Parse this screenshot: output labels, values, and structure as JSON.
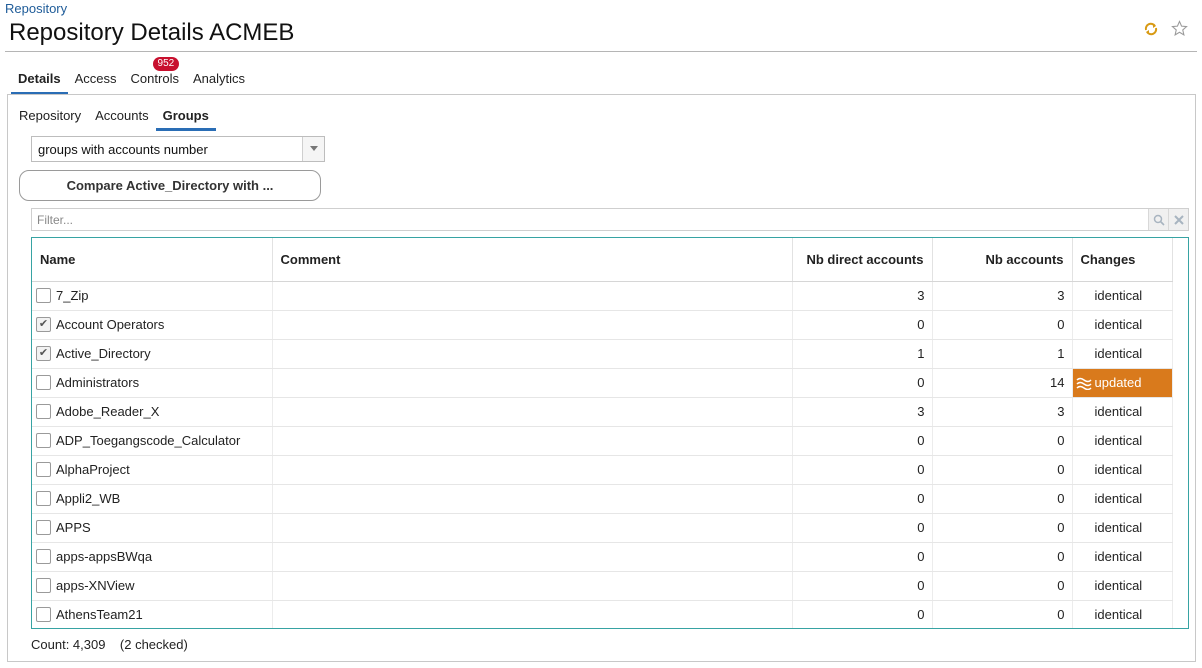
{
  "breadcrumb": "Repository",
  "page_title": "Repository Details ACMEB",
  "main_tabs": [
    {
      "label": "Details",
      "active": true
    },
    {
      "label": "Access",
      "active": false
    },
    {
      "label": "Controls",
      "active": false,
      "badge": "952"
    },
    {
      "label": "Analytics",
      "active": false
    }
  ],
  "sub_tabs": [
    {
      "label": "Repository",
      "active": false
    },
    {
      "label": "Accounts",
      "active": false
    },
    {
      "label": "Groups",
      "active": true
    }
  ],
  "view_select": {
    "value": "groups with accounts number"
  },
  "compare_button": "Compare Active_Directory with ...",
  "filter": {
    "placeholder": "Filter...",
    "value": ""
  },
  "table": {
    "columns": [
      {
        "label": "Name"
      },
      {
        "label": "Comment"
      },
      {
        "label": "Nb direct accounts"
      },
      {
        "label": "Nb accounts"
      },
      {
        "label": "Changes"
      }
    ],
    "rows": [
      {
        "name": "7_Zip",
        "comment": "",
        "direct": "3",
        "accounts": "3",
        "changes": "identical",
        "checked": false
      },
      {
        "name": "Account Operators",
        "comment": "",
        "direct": "0",
        "accounts": "0",
        "changes": "identical",
        "checked": true
      },
      {
        "name": "Active_Directory",
        "comment": "",
        "direct": "1",
        "accounts": "1",
        "changes": "identical",
        "checked": true
      },
      {
        "name": "Administrators",
        "comment": "",
        "direct": "0",
        "accounts": "14",
        "changes": "updated",
        "checked": false
      },
      {
        "name": "Adobe_Reader_X",
        "comment": "",
        "direct": "3",
        "accounts": "3",
        "changes": "identical",
        "checked": false
      },
      {
        "name": "ADP_Toegangscode_Calculator",
        "comment": "",
        "direct": "0",
        "accounts": "0",
        "changes": "identical",
        "checked": false
      },
      {
        "name": "AlphaProject",
        "comment": "",
        "direct": "0",
        "accounts": "0",
        "changes": "identical",
        "checked": false
      },
      {
        "name": "Appli2_WB",
        "comment": "",
        "direct": "0",
        "accounts": "0",
        "changes": "identical",
        "checked": false
      },
      {
        "name": "APPS",
        "comment": "",
        "direct": "0",
        "accounts": "0",
        "changes": "identical",
        "checked": false
      },
      {
        "name": "apps-appsBWqa",
        "comment": "",
        "direct": "0",
        "accounts": "0",
        "changes": "identical",
        "checked": false
      },
      {
        "name": "apps-XNView",
        "comment": "",
        "direct": "0",
        "accounts": "0",
        "changes": "identical",
        "checked": false
      },
      {
        "name": "AthensTeam21",
        "comment": "",
        "direct": "0",
        "accounts": "0",
        "changes": "identical",
        "checked": false
      }
    ]
  },
  "footer": {
    "count": "Count: 4,309",
    "checked": "(2 checked)"
  },
  "colors": {
    "accent": "#2a6db5",
    "updated": "#d97a1c",
    "grid_border": "#37a3a3",
    "badge": "#c8102e"
  },
  "icons": {
    "refresh": "refresh-icon",
    "favorite": "star-icon",
    "search": "search-icon",
    "clear": "clear-icon"
  }
}
